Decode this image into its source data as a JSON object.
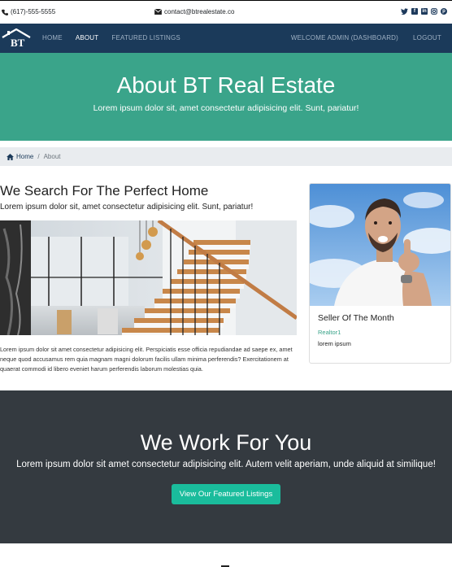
{
  "topbar": {
    "phone": "(617)-555-5555",
    "email": "contact@btrealestate.co",
    "social_icons": [
      "twitter-icon",
      "facebook-icon",
      "linkedin-icon",
      "instagram-icon",
      "pinterest-icon"
    ]
  },
  "navbar": {
    "logo_text": "BT",
    "left_links": [
      {
        "label": "HOME",
        "active": false
      },
      {
        "label": "ABOUT",
        "active": true
      },
      {
        "label": "FEATURED LISTINGS",
        "active": false
      }
    ],
    "right_links": [
      {
        "label": "WELCOME ADMIN (DASHBOARD)"
      },
      {
        "label": "LOGOUT"
      }
    ]
  },
  "hero": {
    "title": "About BT Real Estate",
    "subtitle": "Lorem ipsum dolor sit, amet consectetur adipisicing elit. Sunt, pariatur!"
  },
  "breadcrumb": {
    "home": "Home",
    "separator": "/",
    "current": "About"
  },
  "main": {
    "heading": "We Search For The Perfect Home",
    "subheading": "Lorem ipsum dolor sit, amet consectetur adipisicing elit. Sunt, pariatur!",
    "paragraph": "Lorem ipsum dolor sit amet consectetur adipisicing elit. Perspiciatis esse officia repudiandae ad saepe ex, amet neque quod accusamus rem quia magnam magni dolorum facilis ullam minima perferendis? Exercitationem at quaerat commodi id libero eveniet harum perferendis laborum molestias quia."
  },
  "seller_card": {
    "title": "Seller Of The Month",
    "role": "Realtor1",
    "text": "lorem ipsum"
  },
  "cta_section": {
    "title": "We Work For You",
    "text": "Lorem ipsum dolor sit amet consectetur adipisicing elit. Autem velit aperiam, unde aliquid at similique!",
    "button_label": "View Our Featured Listings"
  },
  "colors": {
    "navbar": "#1b3a5a",
    "hero": "#3aa48a",
    "dark_section": "#343a40",
    "cta_button": "#1abc9c"
  }
}
